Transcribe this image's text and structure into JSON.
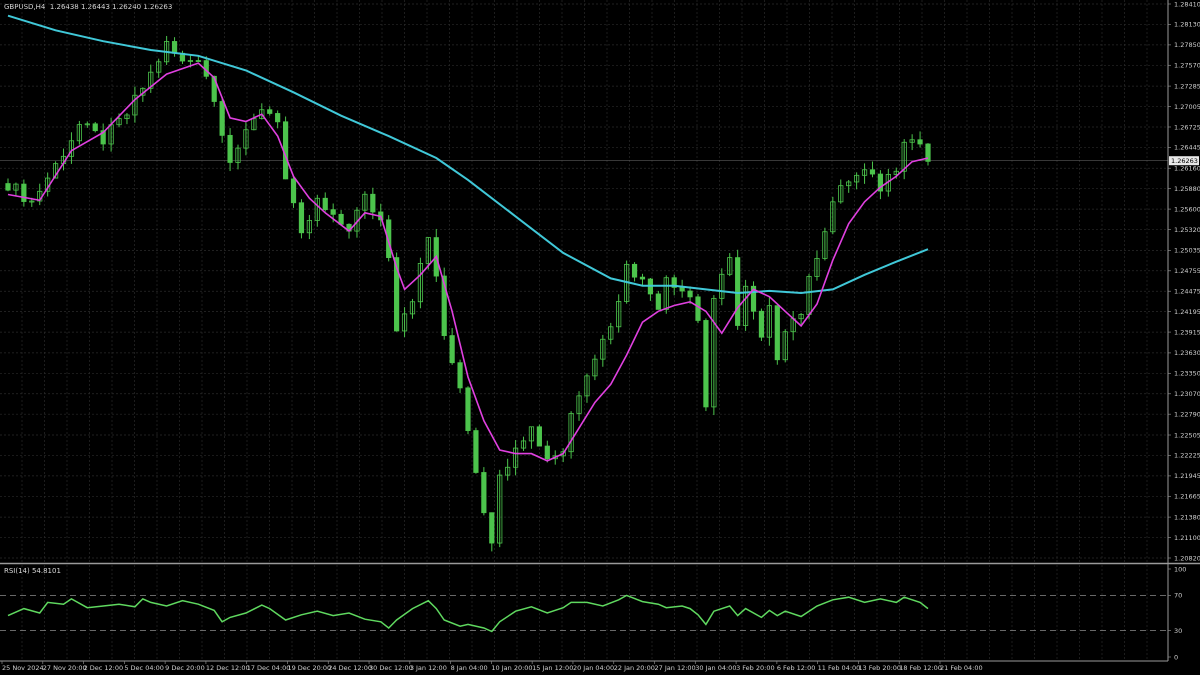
{
  "header": {
    "symbol": "GBPUSD,H4",
    "ohlc": "1.26438 1.26443 1.26240 1.26263"
  },
  "colors": {
    "background": "#000000",
    "grid": "#2a2a2a",
    "candle": "#4cc44c",
    "ma_fast": "#e040e0",
    "ma_slow": "#40c8d8",
    "rsi": "#5fd85f",
    "axis_text": "#cfcfcf"
  },
  "rsi_header": "RSI(14) 54.8101",
  "current_price_label": "1.26263",
  "chart_data": [
    {
      "type": "candlestick",
      "title": "GBPUSD,H4",
      "grid": true,
      "y_axis_ticks": [
        "1.28410",
        "1.28130",
        "1.27850",
        "1.27570",
        "1.27285",
        "1.27005",
        "1.26725",
        "1.26445",
        "1.26160",
        "1.25880",
        "1.25600",
        "1.25320",
        "1.25035",
        "1.24755",
        "1.24475",
        "1.24195",
        "1.23915",
        "1.23630",
        "1.23350",
        "1.23070",
        "1.22790",
        "1.22505",
        "1.22225",
        "1.21945",
        "1.21665",
        "1.21380",
        "1.21100",
        "1.20820"
      ],
      "ylim": [
        1.2082,
        1.2841
      ],
      "x_axis_ticks": [
        "25 Nov 2024",
        "27 Nov 20:00",
        "2 Dec 12:00",
        "5 Dec 04:00",
        "9 Dec 20:00",
        "12 Dec 12:00",
        "17 Dec 04:00",
        "19 Dec 20:00",
        "24 Dec 12:00",
        "30 Dec 12:00",
        "3 Jan 12:00",
        "8 Jan 04:00",
        "10 Jan 20:00",
        "15 Jan 12:00",
        "20 Jan 04:00",
        "22 Jan 20:00",
        "27 Jan 12:00",
        "30 Jan 04:00",
        "3 Feb 20:00",
        "6 Feb 12:00",
        "11 Feb 04:00",
        "13 Feb 20:00",
        "18 Feb 12:00",
        "21 Feb 04:00"
      ],
      "close_path": [
        [
          0,
          1.2595
        ],
        [
          3,
          1.257
        ],
        [
          6,
          1.262
        ],
        [
          9,
          1.2675
        ],
        [
          12,
          1.2655
        ],
        [
          15,
          1.269
        ],
        [
          18,
          1.2745
        ],
        [
          20,
          1.2785
        ],
        [
          22,
          1.276
        ],
        [
          24,
          1.277
        ],
        [
          25,
          1.2745
        ],
        [
          27,
          1.267
        ],
        [
          28,
          1.263
        ],
        [
          30,
          1.266
        ],
        [
          32,
          1.27
        ],
        [
          34,
          1.2685
        ],
        [
          35,
          1.26
        ],
        [
          37,
          1.252
        ],
        [
          39,
          1.257
        ],
        [
          41,
          1.2545
        ],
        [
          43,
          1.2535
        ],
        [
          45,
          1.2575
        ],
        [
          47,
          1.2545
        ],
        [
          48,
          1.25
        ],
        [
          49,
          1.24
        ],
        [
          51,
          1.244
        ],
        [
          53,
          1.252
        ],
        [
          54,
          1.247
        ],
        [
          55,
          1.238
        ],
        [
          57,
          1.232
        ],
        [
          58,
          1.226
        ],
        [
          60,
          1.215
        ],
        [
          61,
          1.211
        ],
        [
          62,
          1.219
        ],
        [
          64,
          1.224
        ],
        [
          66,
          1.226
        ],
        [
          68,
          1.222
        ],
        [
          70,
          1.223
        ],
        [
          71,
          1.228
        ],
        [
          73,
          1.234
        ],
        [
          75,
          1.238
        ],
        [
          77,
          1.243
        ],
        [
          78,
          1.249
        ],
        [
          80,
          1.246
        ],
        [
          82,
          1.243
        ],
        [
          83,
          1.247
        ],
        [
          85,
          1.245
        ],
        [
          86,
          1.244
        ],
        [
          87,
          1.241
        ],
        [
          88,
          1.229
        ],
        [
          89,
          1.243
        ],
        [
          91,
          1.25
        ],
        [
          92,
          1.24
        ],
        [
          93,
          1.245
        ],
        [
          95,
          1.238
        ],
        [
          96,
          1.242
        ],
        [
          97,
          1.236
        ],
        [
          98,
          1.24
        ],
        [
          100,
          1.242
        ],
        [
          102,
          1.25
        ],
        [
          104,
          1.257
        ],
        [
          106,
          1.26
        ],
        [
          108,
          1.261
        ],
        [
          110,
          1.259
        ],
        [
          112,
          1.262
        ],
        [
          113,
          1.266
        ],
        [
          115,
          1.265
        ],
        [
          116,
          1.2626
        ]
      ],
      "series": [
        {
          "values": [
            [
              0,
              1.258
            ],
            [
              4,
              1.2572
            ],
            [
              8,
              1.264
            ],
            [
              12,
              1.2665
            ],
            [
              16,
              1.271
            ],
            [
              20,
              1.2745
            ],
            [
              24,
              1.276
            ],
            [
              26,
              1.274
            ],
            [
              28,
              1.2685
            ],
            [
              30,
              1.268
            ],
            [
              32,
              1.269
            ],
            [
              34,
              1.266
            ],
            [
              36,
              1.2605
            ],
            [
              38,
              1.2575
            ],
            [
              40,
              1.2555
            ],
            [
              43,
              1.253
            ],
            [
              45,
              1.2555
            ],
            [
              47,
              1.255
            ],
            [
              49,
              1.248
            ],
            [
              50,
              1.245
            ],
            [
              52,
              1.247
            ],
            [
              54,
              1.2495
            ],
            [
              56,
              1.242
            ],
            [
              58,
              1.233
            ],
            [
              60,
              1.227
            ],
            [
              62,
              1.223
            ],
            [
              64,
              1.2225
            ],
            [
              66,
              1.2225
            ],
            [
              68,
              1.2215
            ],
            [
              70,
              1.2225
            ],
            [
              72,
              1.226
            ],
            [
              74,
              1.2295
            ],
            [
              76,
              1.232
            ],
            [
              78,
              1.236
            ],
            [
              80,
              1.2405
            ],
            [
              82,
              1.242
            ],
            [
              84,
              1.2428
            ],
            [
              86,
              1.2433
            ],
            [
              88,
              1.242
            ],
            [
              90,
              1.239
            ],
            [
              92,
              1.2425
            ],
            [
              94,
              1.245
            ],
            [
              96,
              1.244
            ],
            [
              98,
              1.242
            ],
            [
              100,
              1.24
            ],
            [
              102,
              1.243
            ],
            [
              104,
              1.249
            ],
            [
              106,
              1.254
            ],
            [
              108,
              1.257
            ],
            [
              110,
              1.259
            ],
            [
              112,
              1.2605
            ],
            [
              114,
              1.2625
            ],
            [
              116,
              1.263
            ]
          ]
        },
        {
          "values": [
            [
              0,
              1.2825
            ],
            [
              6,
              1.2805
            ],
            [
              12,
              1.279
            ],
            [
              18,
              1.2778
            ],
            [
              24,
              1.277
            ],
            [
              30,
              1.275
            ],
            [
              36,
              1.272
            ],
            [
              42,
              1.2688
            ],
            [
              48,
              1.266
            ],
            [
              54,
              1.263
            ],
            [
              58,
              1.26
            ],
            [
              64,
              1.255
            ],
            [
              70,
              1.25
            ],
            [
              76,
              1.2465
            ],
            [
              80,
              1.2455
            ],
            [
              84,
              1.2455
            ],
            [
              88,
              1.245
            ],
            [
              92,
              1.2445
            ],
            [
              96,
              1.2448
            ],
            [
              100,
              1.2445
            ],
            [
              104,
              1.245
            ],
            [
              108,
              1.247
            ],
            [
              112,
              1.2488
            ],
            [
              116,
              1.2505
            ]
          ]
        }
      ]
    },
    {
      "type": "line",
      "title": "RSI(14) 54.8101",
      "ylim": [
        0,
        100
      ],
      "y_axis_ticks": [
        "100",
        "70",
        "30",
        "0"
      ],
      "levels": [
        70,
        30
      ],
      "series": [
        {
          "values": [
            [
              0,
              47
            ],
            [
              2,
              55
            ],
            [
              4,
              50
            ],
            [
              5,
              62
            ],
            [
              7,
              60
            ],
            [
              8,
              66
            ],
            [
              10,
              56
            ],
            [
              12,
              58
            ],
            [
              14,
              60
            ],
            [
              16,
              57
            ],
            [
              17,
              66
            ],
            [
              18,
              62
            ],
            [
              20,
              58
            ],
            [
              22,
              64
            ],
            [
              24,
              60
            ],
            [
              26,
              53
            ],
            [
              27,
              40
            ],
            [
              28,
              45
            ],
            [
              30,
              50
            ],
            [
              32,
              59
            ],
            [
              33,
              55
            ],
            [
              35,
              42
            ],
            [
              37,
              48
            ],
            [
              39,
              52
            ],
            [
              41,
              47
            ],
            [
              43,
              50
            ],
            [
              45,
              43
            ],
            [
              47,
              40
            ],
            [
              48,
              33
            ],
            [
              49,
              42
            ],
            [
              51,
              55
            ],
            [
              53,
              64
            ],
            [
              54,
              55
            ],
            [
              55,
              42
            ],
            [
              57,
              35
            ],
            [
              58,
              37
            ],
            [
              60,
              33
            ],
            [
              61,
              29
            ],
            [
              62,
              40
            ],
            [
              64,
              52
            ],
            [
              66,
              57
            ],
            [
              68,
              50
            ],
            [
              70,
              56
            ],
            [
              71,
              62
            ],
            [
              73,
              62
            ],
            [
              75,
              58
            ],
            [
              77,
              65
            ],
            [
              78,
              70
            ],
            [
              80,
              63
            ],
            [
              82,
              60
            ],
            [
              83,
              56
            ],
            [
              85,
              58
            ],
            [
              86,
              55
            ],
            [
              87,
              48
            ],
            [
              88,
              37
            ],
            [
              89,
              52
            ],
            [
              91,
              58
            ],
            [
              92,
              47
            ],
            [
              93,
              55
            ],
            [
              95,
              45
            ],
            [
              96,
              53
            ],
            [
              97,
              47
            ],
            [
              98,
              52
            ],
            [
              100,
              46
            ],
            [
              102,
              58
            ],
            [
              104,
              65
            ],
            [
              106,
              68
            ],
            [
              108,
              62
            ],
            [
              110,
              66
            ],
            [
              112,
              62
            ],
            [
              113,
              68
            ],
            [
              115,
              62
            ],
            [
              116,
              55
            ]
          ]
        }
      ]
    }
  ]
}
